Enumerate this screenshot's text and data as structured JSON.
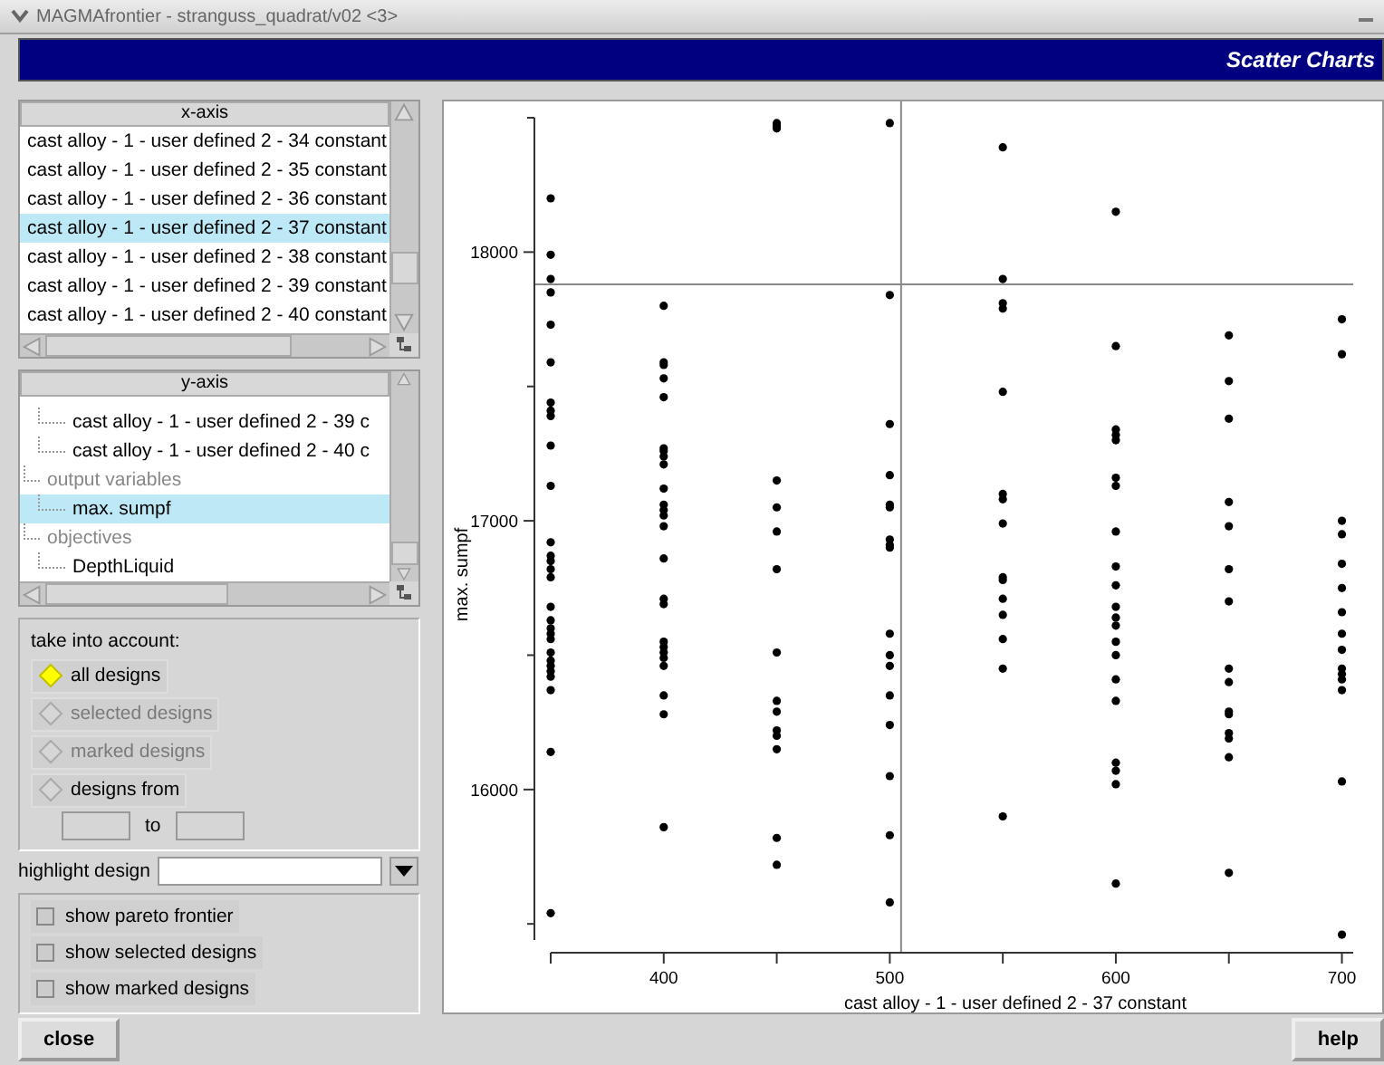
{
  "window": {
    "title": "MAGMAfrontier - stranguss_quadrat/v02 <3>"
  },
  "header": {
    "title": "Scatter Charts"
  },
  "x_axis_list": {
    "header": "x-axis",
    "items": [
      {
        "label": "cast alloy - 1 - user defined 2 - 34 constant",
        "selected": false
      },
      {
        "label": "cast alloy - 1 - user defined 2 - 35 constant",
        "selected": false
      },
      {
        "label": "cast alloy - 1 - user defined 2 - 36 constant",
        "selected": false
      },
      {
        "label": "cast alloy - 1 - user defined 2 - 37 constant",
        "selected": true
      },
      {
        "label": "cast alloy - 1 - user defined 2 - 38 constant",
        "selected": false
      },
      {
        "label": "cast alloy - 1 - user defined 2 - 39 constant",
        "selected": false
      },
      {
        "label": "cast alloy - 1 - user defined 2 - 40 constant",
        "selected": false
      }
    ]
  },
  "y_axis_tree": {
    "header": "y-axis",
    "nodes": [
      {
        "children": [
          {
            "label": "cast alloy - 1 - user defined 2 - 39 c",
            "selected": false
          },
          {
            "label": "cast alloy - 1 - user defined 2 - 40 c",
            "selected": false
          }
        ]
      },
      {
        "label": "output variables",
        "children": [
          {
            "label": "max. sumpf",
            "selected": true
          }
        ]
      },
      {
        "label": "objectives",
        "children": [
          {
            "label": "DepthLiquid",
            "selected": false
          }
        ]
      }
    ]
  },
  "take_into_account": {
    "label": "take into account:",
    "options": [
      {
        "label": "all designs",
        "selected": true,
        "disabled": false
      },
      {
        "label": "selected designs",
        "selected": false,
        "disabled": true
      },
      {
        "label": "marked designs",
        "selected": false,
        "disabled": true
      },
      {
        "label": "designs from",
        "selected": false,
        "disabled": false
      }
    ],
    "range_separator": "to"
  },
  "highlight_design": {
    "label": "highlight design"
  },
  "checkboxes": [
    {
      "label": "show pareto frontier",
      "checked": false
    },
    {
      "label": "show selected designs",
      "checked": false
    },
    {
      "label": "show marked designs",
      "checked": false
    }
  ],
  "chart": {
    "chart_data": {
      "type": "scatter",
      "xlabel": "cast alloy - 1 - user defined 2 - 37 constant",
      "ylabel": "max. sumpf",
      "xlim": [
        350,
        705
      ],
      "ylim": [
        15440,
        18500
      ],
      "xticks": [
        400,
        500,
        600,
        700
      ],
      "yticks": [
        16000,
        17000,
        18000
      ],
      "x": [
        350,
        350,
        350,
        350,
        350,
        350,
        350,
        350,
        350,
        350,
        350,
        350,
        350,
        350,
        350,
        350,
        350,
        350,
        350,
        350,
        350,
        350,
        350,
        350,
        350,
        350,
        350,
        350,
        350,
        400,
        400,
        400,
        400,
        400,
        400,
        400,
        400,
        400,
        400,
        400,
        400,
        400,
        400,
        400,
        400,
        400,
        400,
        400,
        400,
        400,
        400,
        400,
        400,
        400,
        450,
        450,
        450,
        450,
        450,
        450,
        450,
        450,
        450,
        450,
        450,
        450,
        450,
        450,
        450,
        500,
        500,
        500,
        500,
        500,
        500,
        500,
        500,
        500,
        500,
        500,
        500,
        500,
        500,
        500,
        500,
        500,
        550,
        550,
        550,
        550,
        550,
        550,
        550,
        550,
        550,
        550,
        550,
        550,
        550,
        550,
        550,
        600,
        600,
        600,
        600,
        600,
        600,
        600,
        600,
        600,
        600,
        600,
        600,
        600,
        600,
        600,
        600,
        600,
        600,
        600,
        600,
        600,
        650,
        650,
        650,
        650,
        650,
        650,
        650,
        650,
        650,
        650,
        650,
        650,
        650,
        650,
        650,
        700,
        700,
        700,
        700,
        700,
        700,
        700,
        700,
        700,
        700,
        700,
        700,
        700,
        700,
        700
      ],
      "series": [
        {
          "color": "#000000",
          "values": [
            18200,
            17990,
            17900,
            17850,
            17730,
            17590,
            17440,
            17410,
            17390,
            17280,
            17130,
            16920,
            16870,
            16850,
            16820,
            16790,
            16680,
            16630,
            16600,
            16580,
            16560,
            16510,
            16480,
            16460,
            16440,
            16420,
            16370,
            16140,
            15540,
            17800,
            17590,
            17580,
            17530,
            17460,
            17270,
            17260,
            17240,
            17210,
            17120,
            17060,
            17040,
            17020,
            16980,
            16860,
            16710,
            16690,
            16550,
            16530,
            16510,
            16490,
            16460,
            16350,
            16280,
            15860,
            18480,
            18470,
            18460,
            17150,
            17050,
            16960,
            16820,
            16510,
            16330,
            16290,
            16220,
            16200,
            16150,
            15820,
            15720,
            18480,
            17840,
            17360,
            17170,
            17060,
            17050,
            16930,
            16910,
            16900,
            16580,
            16500,
            16460,
            16350,
            16240,
            16050,
            15830,
            15580,
            18390,
            17900,
            17810,
            17790,
            17480,
            17100,
            17080,
            16990,
            16790,
            16780,
            16710,
            16650,
            16560,
            16450,
            15900,
            18150,
            17650,
            17340,
            17320,
            17300,
            17160,
            17130,
            16960,
            16830,
            16760,
            16680,
            16640,
            16610,
            16550,
            16500,
            16410,
            16330,
            16100,
            16070,
            16020,
            15650,
            17690,
            17520,
            17380,
            17070,
            16980,
            16820,
            16700,
            16450,
            16400,
            16290,
            16280,
            16210,
            16190,
            16120,
            15690,
            17750,
            17620,
            17000,
            16950,
            16840,
            16750,
            16660,
            16580,
            16520,
            16450,
            16430,
            16410,
            16370,
            16030,
            15460
          ]
        }
      ],
      "ref_lines": [
        {
          "axis": "x",
          "value": 505
        },
        {
          "axis": "y",
          "value": 17880
        }
      ]
    }
  },
  "buttons": [
    {
      "label": "close"
    },
    {
      "label": "help"
    }
  ]
}
